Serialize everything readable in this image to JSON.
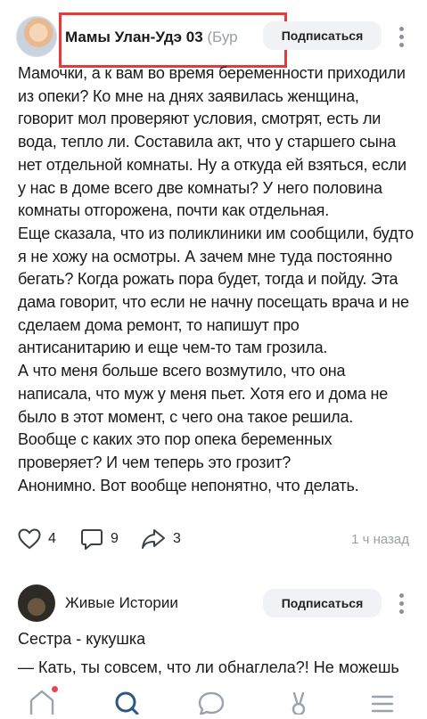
{
  "post": {
    "author": "Мамы Улан-Удэ 03",
    "author_suffix": " (Бур",
    "subscribe_label": "Подписаться",
    "paragraphs": [
      "Мамочки, а к вам во время беременности приходили из опеки? Ко мне на днях заявилась женщина, говорит мол проверяют условия, смотрят, есть ли вода, тепло ли. Составила акт, что у старшего сына нет отдельной комнаты. Ну а откуда ей взяться, если у нас в доме всего две комнаты? У него половина комнаты отгорожена, почти как отдельная.",
      "Еще сказала, что из поликлиники им сообщили, будто я не хожу на осмотры. А зачем мне туда постоянно бегать? Когда рожать пора будет, тогда и пойду. Эта дама говорит, что если не начну посещать врача и не сделаем дома ремонт, то напишут про антисанитарию и еще чем-то там грозила.",
      "А что меня больше всего возмутило, что она написала, что муж у меня пьет. Хотя его и дома не было в этот момент, с чего она такое решила. Вообще с каких это пор опека беременных проверяет? И чем теперь это грозит?",
      "Анонимно. Вот вообще непонятно, что делать."
    ],
    "likes": "4",
    "comments": "9",
    "shares": "3",
    "time": "1 ч назад"
  },
  "post2": {
    "author": "Живые Истории",
    "subscribe_label": "Подписаться",
    "title": "Сестра - кукушка",
    "first_line": "— Кать, ты совсем, что ли обнаглела?! Не можешь"
  },
  "colors": {
    "accent": "#2a5885",
    "highlight": "#e5393b",
    "badge": "#e64646"
  },
  "tabbar": {
    "icons": [
      "home-icon",
      "search-icon",
      "messages-icon",
      "clips-icon",
      "menu-icon"
    ],
    "active": "search-icon"
  }
}
